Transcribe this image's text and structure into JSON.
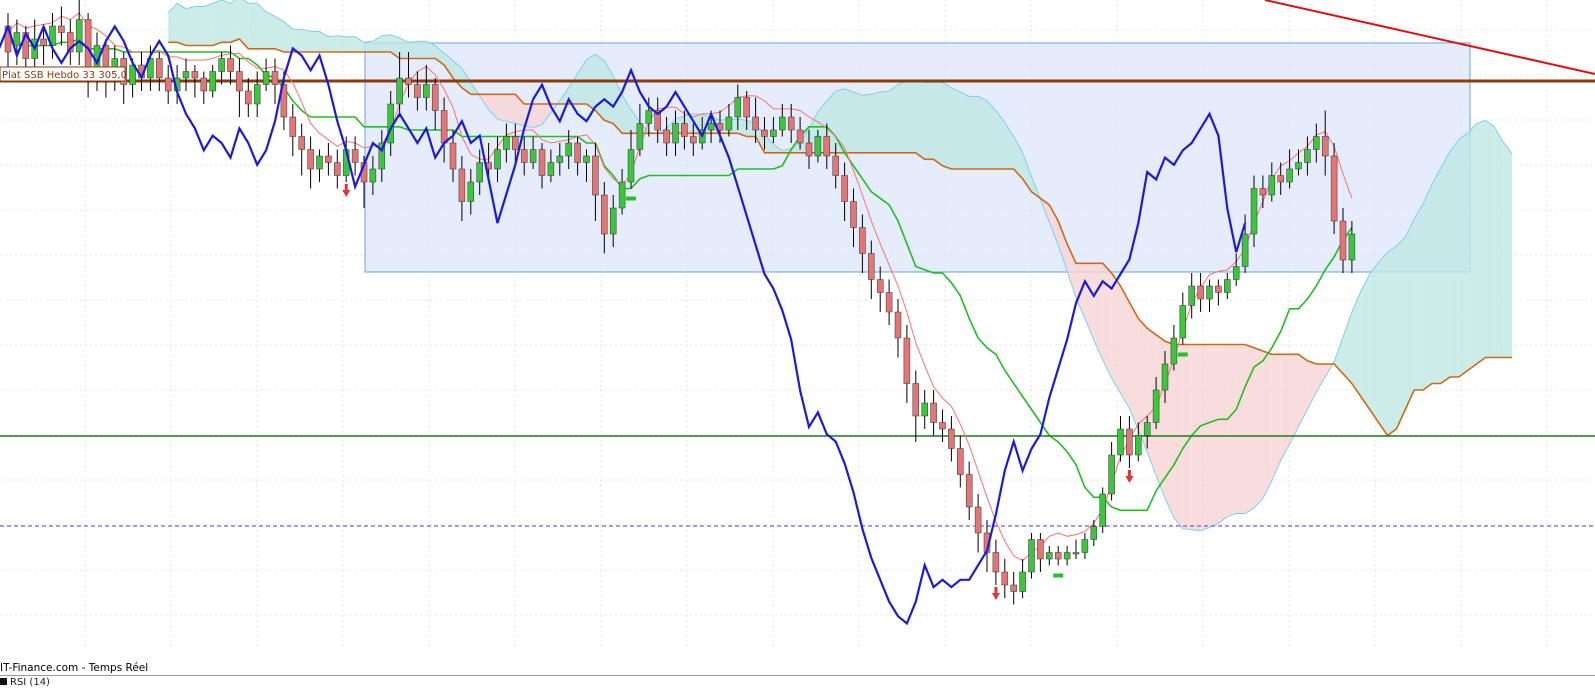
{
  "colors": {
    "background": "#ffffff",
    "grid": "#e6e6e6",
    "bull_candle": "#3ec43e",
    "bear_candle": "#e27676",
    "wick": "#000000",
    "tenkan": "#ff7070",
    "kijun": "#cc6a1a",
    "chikou": "#1a1adc",
    "senkou_b_green": "#1fbf1f",
    "kumo_line": "#7fcff0",
    "bear_cloud": "#f7d4d4",
    "bull_cloud": "#bfe7e2",
    "zone_fill": "#dce6fb",
    "zone_border": "#6ea0e8",
    "resistance_line": "#8b3a0a",
    "trend_line": "#e01010",
    "support_line": "#1f7a1f",
    "dashed_line": "#5a3fbf",
    "arrow_down": "#e03535",
    "signal_green": "#2bbd2b"
  },
  "resistance_label": "Plat SSB Hebdo 33 305,0",
  "footer_text": "IT-Finance.com - Temps Réel",
  "indicator_label": "RSI (14)",
  "chart_data": {
    "type": "candlestick",
    "title": "",
    "xlabel": "",
    "ylabel": "",
    "ylim": [
      0,
      100
    ],
    "candles": [
      [
        96,
        92,
        98,
        89
      ],
      [
        93,
        95,
        97,
        90
      ],
      [
        95,
        91,
        96,
        88
      ],
      [
        91,
        94,
        97,
        89
      ],
      [
        94,
        93,
        96,
        90
      ],
      [
        93,
        96,
        98,
        91
      ],
      [
        96,
        95,
        99,
        93
      ],
      [
        95,
        92,
        97,
        90
      ],
      [
        92,
        97,
        100,
        90
      ],
      [
        97,
        88,
        98,
        85
      ],
      [
        88,
        93,
        95,
        86
      ],
      [
        93,
        88,
        94,
        85
      ],
      [
        88,
        91,
        93,
        86
      ],
      [
        91,
        87,
        92,
        84
      ],
      [
        87,
        90,
        91,
        85
      ],
      [
        90,
        88,
        92,
        86
      ],
      [
        88,
        91,
        93,
        86
      ],
      [
        91,
        88,
        92,
        86
      ],
      [
        88,
        86,
        90,
        84
      ],
      [
        86,
        88,
        90,
        84
      ],
      [
        88,
        89,
        91,
        86
      ],
      [
        89,
        88,
        90,
        85
      ],
      [
        88,
        86,
        89,
        84
      ],
      [
        86,
        89,
        90,
        85
      ],
      [
        89,
        91,
        92,
        87
      ],
      [
        91,
        89,
        93,
        87
      ],
      [
        89,
        86,
        91,
        82
      ],
      [
        86,
        84,
        88,
        82
      ],
      [
        84,
        87,
        89,
        82
      ],
      [
        87,
        89,
        91,
        86
      ],
      [
        89,
        87,
        91,
        84
      ],
      [
        87,
        82,
        89,
        80
      ],
      [
        82,
        79,
        84,
        76
      ],
      [
        79,
        77,
        81,
        73
      ],
      [
        77,
        74,
        79,
        71
      ],
      [
        74,
        76,
        77,
        72
      ],
      [
        76,
        75,
        78,
        73
      ],
      [
        75,
        73,
        77,
        71
      ],
      [
        73,
        77,
        79,
        72
      ],
      [
        77,
        75,
        79,
        73
      ],
      [
        75,
        72,
        76,
        68
      ],
      [
        72,
        74,
        76,
        70
      ],
      [
        74,
        78,
        80,
        72
      ],
      [
        78,
        84,
        86,
        76
      ],
      [
        84,
        88,
        92,
        82
      ],
      [
        88,
        87,
        92,
        85
      ],
      [
        87,
        85,
        89,
        83
      ],
      [
        85,
        87,
        90,
        83
      ],
      [
        87,
        83,
        88,
        80
      ],
      [
        83,
        78,
        85,
        75
      ],
      [
        78,
        74,
        80,
        72
      ],
      [
        74,
        69,
        76,
        66
      ],
      [
        69,
        72,
        74,
        67
      ],
      [
        72,
        75,
        77,
        70
      ],
      [
        75,
        74,
        78,
        72
      ],
      [
        74,
        77,
        79,
        72
      ],
      [
        77,
        79,
        81,
        75
      ],
      [
        79,
        77,
        81,
        75
      ],
      [
        77,
        75,
        79,
        73
      ],
      [
        75,
        77,
        79,
        74
      ],
      [
        77,
        73,
        78,
        71
      ],
      [
        73,
        75,
        77,
        72
      ],
      [
        75,
        76,
        78,
        73
      ],
      [
        76,
        78,
        80,
        74
      ],
      [
        78,
        75,
        79,
        73
      ],
      [
        75,
        76,
        77,
        72
      ],
      [
        76,
        70,
        78,
        66
      ],
      [
        70,
        64,
        72,
        61
      ],
      [
        64,
        68,
        70,
        62
      ],
      [
        68,
        72,
        74,
        67
      ],
      [
        72,
        77,
        80,
        71
      ],
      [
        77,
        81,
        84,
        76
      ],
      [
        81,
        83,
        85,
        79
      ],
      [
        83,
        80,
        85,
        78
      ],
      [
        80,
        78,
        82,
        76
      ],
      [
        78,
        81,
        83,
        76
      ],
      [
        81,
        79,
        83,
        77
      ],
      [
        79,
        78,
        81,
        76
      ],
      [
        78,
        80,
        82,
        77
      ],
      [
        80,
        81,
        83,
        78
      ],
      [
        81,
        80,
        83,
        78
      ],
      [
        80,
        82,
        84,
        79
      ],
      [
        82,
        85,
        87,
        80
      ],
      [
        85,
        82,
        86,
        80
      ],
      [
        82,
        80,
        85,
        78
      ],
      [
        80,
        79,
        82,
        77
      ],
      [
        79,
        80,
        82,
        78
      ],
      [
        80,
        82,
        84,
        79
      ],
      [
        82,
        80,
        84,
        78
      ],
      [
        80,
        78,
        82,
        77
      ],
      [
        78,
        76,
        80,
        74
      ],
      [
        76,
        79,
        80,
        75
      ],
      [
        79,
        76,
        81,
        74
      ],
      [
        76,
        73,
        78,
        71
      ],
      [
        73,
        69,
        75,
        66
      ],
      [
        69,
        65,
        71,
        62
      ],
      [
        65,
        61,
        67,
        58
      ],
      [
        61,
        57,
        63,
        54
      ],
      [
        57,
        55,
        59,
        52
      ],
      [
        55,
        52,
        57,
        50
      ],
      [
        52,
        48,
        54,
        45
      ],
      [
        48,
        41,
        50,
        38
      ],
      [
        41,
        36,
        43,
        32
      ],
      [
        36,
        38,
        40,
        34
      ],
      [
        38,
        35,
        40,
        33
      ],
      [
        35,
        34,
        37,
        32
      ],
      [
        34,
        31,
        36,
        29
      ],
      [
        31,
        27,
        33,
        25
      ],
      [
        27,
        22,
        29,
        20
      ],
      [
        22,
        18,
        24,
        15
      ],
      [
        18,
        15,
        20,
        12
      ],
      [
        15,
        12,
        17,
        10
      ],
      [
        12,
        10,
        14,
        8
      ],
      [
        10,
        9,
        12,
        7
      ],
      [
        9,
        12,
        14,
        8
      ],
      [
        12,
        17,
        18,
        11
      ],
      [
        17,
        14,
        18,
        12
      ],
      [
        14,
        15,
        16,
        13
      ],
      [
        15,
        14,
        16,
        13
      ],
      [
        14,
        15,
        16,
        13
      ],
      [
        15,
        15,
        17,
        14
      ],
      [
        15,
        17,
        18,
        14
      ],
      [
        17,
        19,
        20,
        16
      ],
      [
        19,
        24,
        25,
        18
      ],
      [
        24,
        30,
        32,
        23
      ],
      [
        30,
        34,
        36,
        29
      ],
      [
        34,
        30,
        36,
        28
      ],
      [
        30,
        33,
        35,
        29
      ],
      [
        33,
        35,
        36,
        31
      ],
      [
        35,
        40,
        42,
        34
      ],
      [
        40,
        44,
        46,
        38
      ],
      [
        44,
        48,
        50,
        43
      ],
      [
        48,
        53,
        55,
        47
      ],
      [
        53,
        56,
        58,
        51
      ],
      [
        56,
        54,
        58,
        52
      ],
      [
        54,
        56,
        57,
        52
      ],
      [
        56,
        55,
        57,
        53
      ],
      [
        55,
        57,
        58,
        54
      ],
      [
        57,
        59,
        61,
        56
      ],
      [
        59,
        64,
        67,
        58
      ],
      [
        64,
        71,
        73,
        62
      ],
      [
        71,
        70,
        73,
        68
      ],
      [
        70,
        73,
        75,
        69
      ],
      [
        73,
        72,
        75,
        70
      ],
      [
        72,
        74,
        77,
        71
      ],
      [
        74,
        75,
        77,
        73
      ],
      [
        75,
        77,
        79,
        73
      ],
      [
        77,
        79,
        81,
        75
      ],
      [
        79,
        76,
        83,
        73
      ],
      [
        76,
        66,
        78,
        64
      ],
      [
        66,
        60,
        68,
        58
      ],
      [
        60,
        64,
        66,
        58
      ]
    ]
  }
}
